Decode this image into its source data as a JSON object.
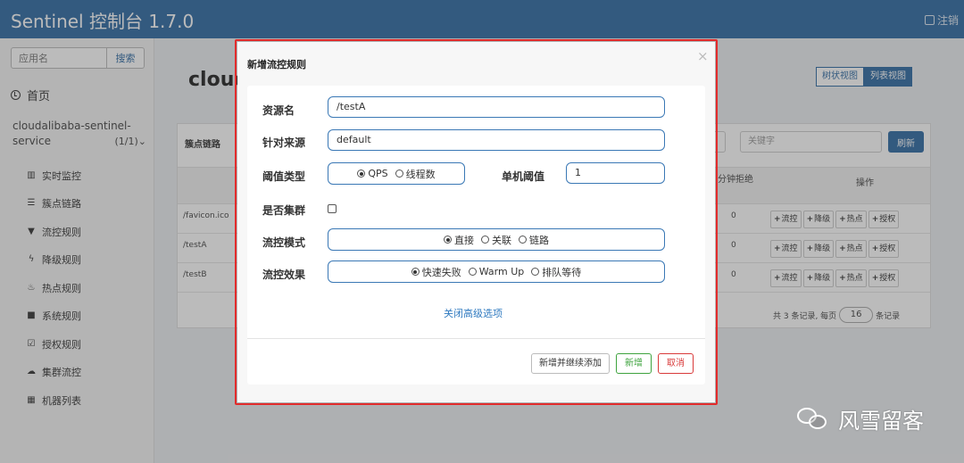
{
  "navbar": {
    "brand": "Sentinel 控制台 1.7.0",
    "logout": "注销"
  },
  "sidebar": {
    "search_placeholder": "应用名",
    "search_button": "搜索",
    "home": "首页",
    "app_name": "cloudalibaba-sentinel-service",
    "app_count": "(1/1)",
    "items": [
      {
        "label": "实时监控",
        "icon": "bar-chart-icon"
      },
      {
        "label": "簇点链路",
        "icon": "list-icon"
      },
      {
        "label": "流控规则",
        "icon": "filter-icon"
      },
      {
        "label": "降级规则",
        "icon": "flash-icon"
      },
      {
        "label": "热点规则",
        "icon": "fire-icon"
      },
      {
        "label": "系统规则",
        "icon": "lock-icon"
      },
      {
        "label": "授权规则",
        "icon": "check-icon"
      },
      {
        "label": "集群流控",
        "icon": "cloud-icon"
      },
      {
        "label": "机器列表",
        "icon": "th-list-icon"
      }
    ]
  },
  "main": {
    "heading": "cloud",
    "view_tree": "树状视图",
    "view_list": "列表视图",
    "panel_title": "簇点链路",
    "keyword_placeholder": "关键字",
    "refresh": "刷新",
    "col_reject": "分钟拒绝",
    "col_ops": "操作",
    "rows": [
      {
        "resource": "/favicon.ico",
        "reject": "0"
      },
      {
        "resource": "/testA",
        "reject": "0"
      },
      {
        "resource": "/testB",
        "reject": "0"
      }
    ],
    "op_buttons": [
      "流控",
      "降级",
      "热点",
      "授权"
    ],
    "pager_prefix": "共 3 条记录, 每页",
    "pager_size": "16",
    "pager_suffix": "条记录"
  },
  "modal": {
    "title": "新增流控规则",
    "close": "×",
    "resource_label": "资源名",
    "resource_value": "/testA",
    "origin_label": "针对来源",
    "origin_value": "default",
    "threshold_type_label": "阈值类型",
    "threshold_type_options": [
      "QPS",
      "线程数"
    ],
    "threshold_type_selected": "QPS",
    "threshold_label": "单机阈值",
    "threshold_value": "1",
    "cluster_label": "是否集群",
    "mode_label": "流控模式",
    "mode_options": [
      "直接",
      "关联",
      "链路"
    ],
    "mode_selected": "直接",
    "effect_label": "流控效果",
    "effect_options": [
      "快速失败",
      "Warm Up",
      "排队等待"
    ],
    "effect_selected": "快速失败",
    "advanced_link": "关闭高级选项",
    "btn_add_continue": "新增并继续添加",
    "btn_add": "新增",
    "btn_cancel": "取消"
  },
  "watermark": {
    "text": "风雪留客",
    "icon": "wechat-icon"
  }
}
